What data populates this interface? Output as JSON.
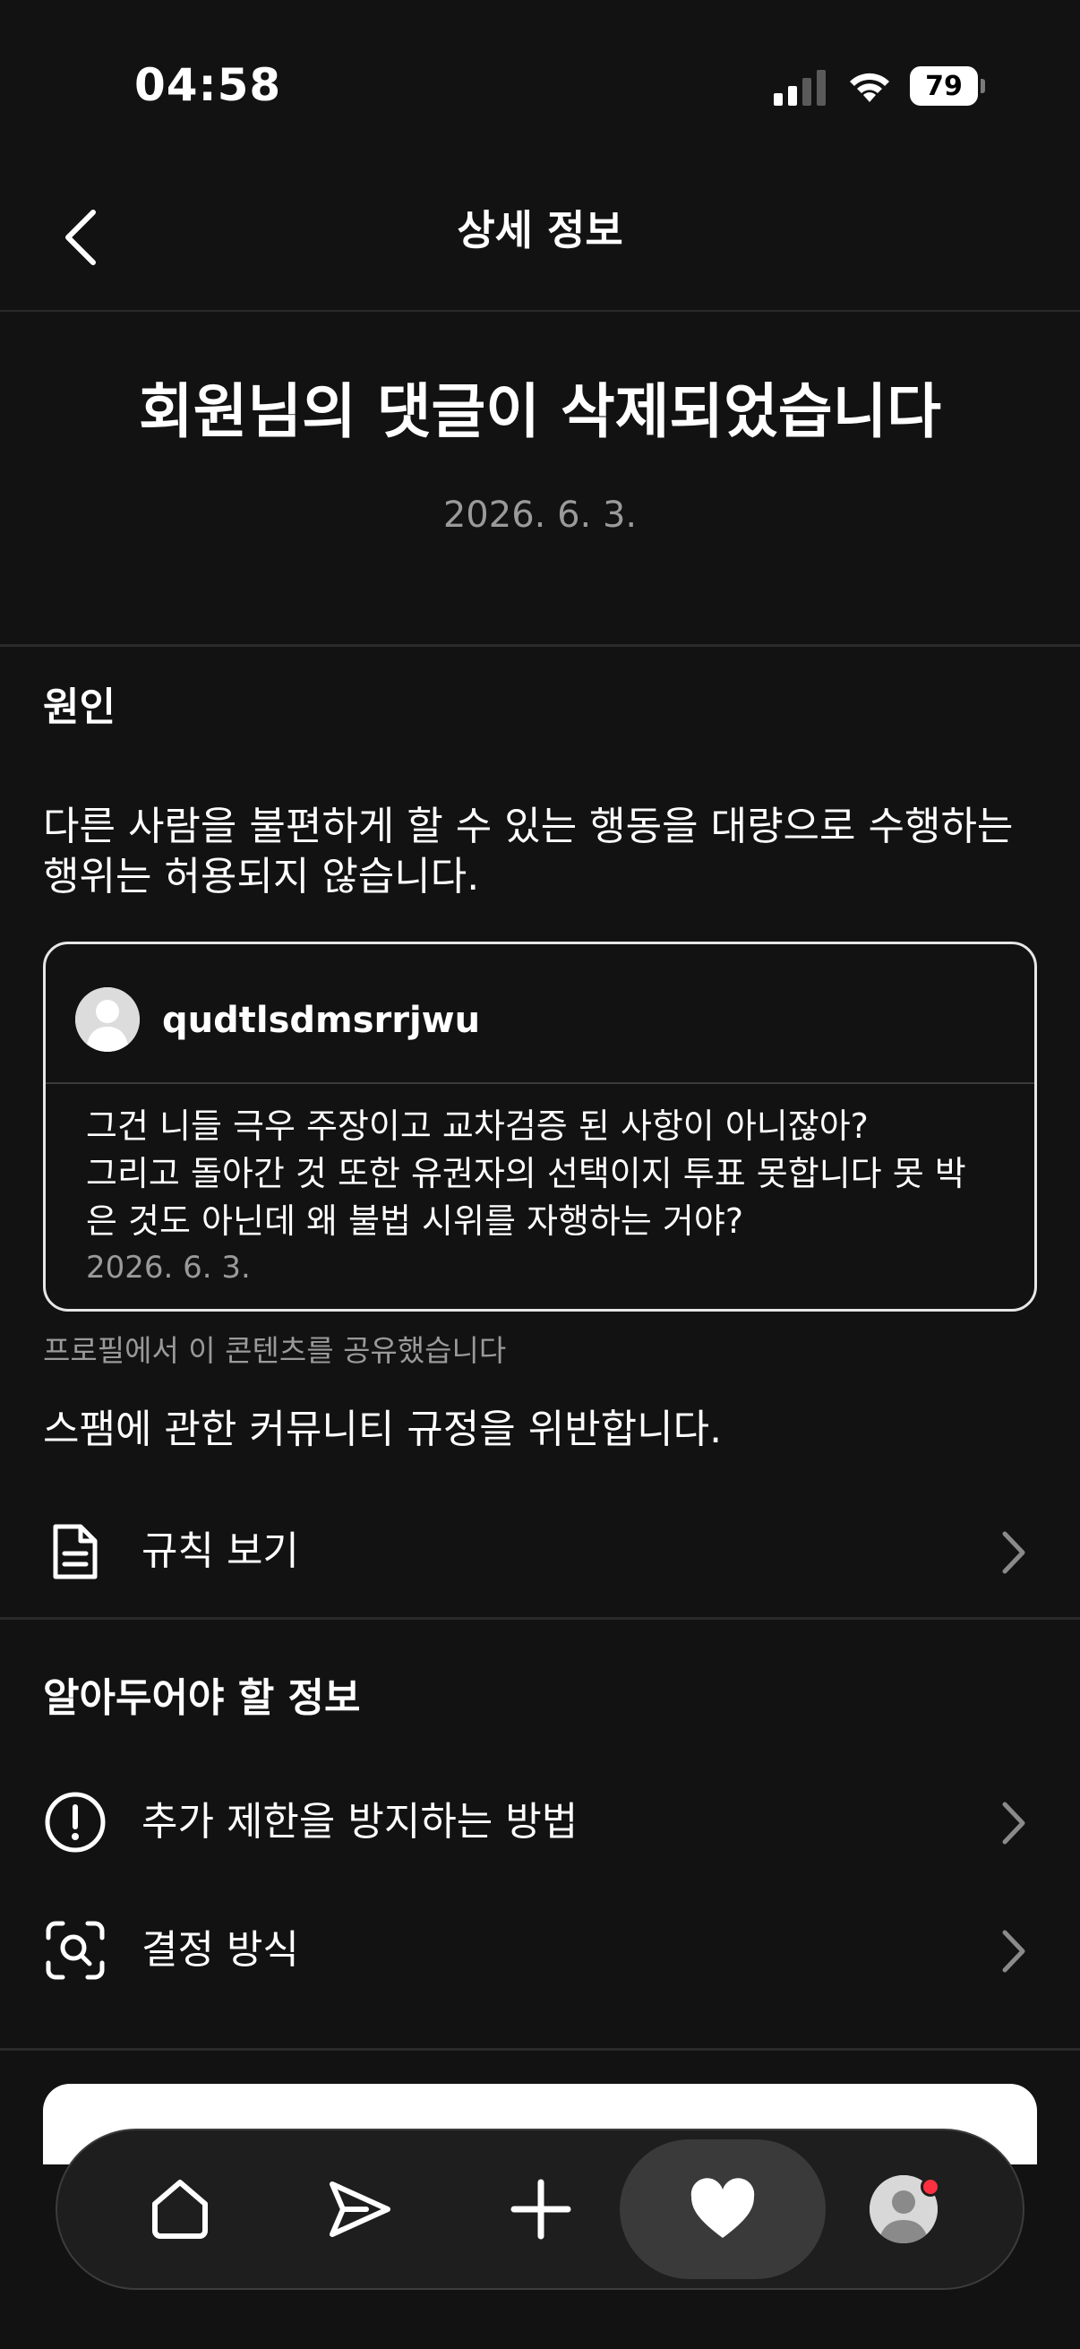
{
  "status_bar": {
    "time": "04:58",
    "battery": "79"
  },
  "header": {
    "title": "상세 정보"
  },
  "headline": {
    "title": "회원님의 댓글이 삭제되었습니다",
    "date": "2026. 6. 3."
  },
  "reason": {
    "section_title": "원인",
    "text": "다른 사람을 불편하게 할 수 있는 행동을 대량으로 수행하는 행위는 허용되지 않습니다."
  },
  "comment": {
    "username": "qudtlsdmsrrjwu",
    "body_lines": [
      "그건 니들 극우 주장이고 교차검증 된 사항이 아니잖아?",
      "그리고 돌아간 것 또한 유권자의 선택이지 투표 못합니다 못 박",
      "은 것도 아닌데 왜 불법 시위를 자행하는 거야?"
    ],
    "date": "2026. 6. 3."
  },
  "shared_note": "프로필에서 이 콘텐츠를 공유했습니다",
  "violation": "스팸에 관한 커뮤니티 규정을 위반합니다.",
  "rules_row": {
    "label": "규칙 보기",
    "icon": "document-icon"
  },
  "info": {
    "section_title": "알아두어야 할 정보",
    "items": [
      {
        "label": "추가 제한을 방지하는 방법",
        "icon": "exclamation-circle-icon"
      },
      {
        "label": "결정 방식",
        "icon": "scan-search-icon"
      }
    ]
  },
  "tab_bar": {
    "tabs": [
      {
        "name": "home",
        "icon": "home-icon"
      },
      {
        "name": "messages",
        "icon": "send-icon"
      },
      {
        "name": "create",
        "icon": "plus-icon"
      },
      {
        "name": "activity",
        "icon": "heart-icon",
        "active": true
      },
      {
        "name": "profile",
        "icon": "profile-avatar-icon"
      }
    ]
  },
  "colors": {
    "background": "#121212",
    "text": "#ffffff",
    "secondary_text": "#9a9a9a",
    "notification_dot": "#ff3040"
  }
}
